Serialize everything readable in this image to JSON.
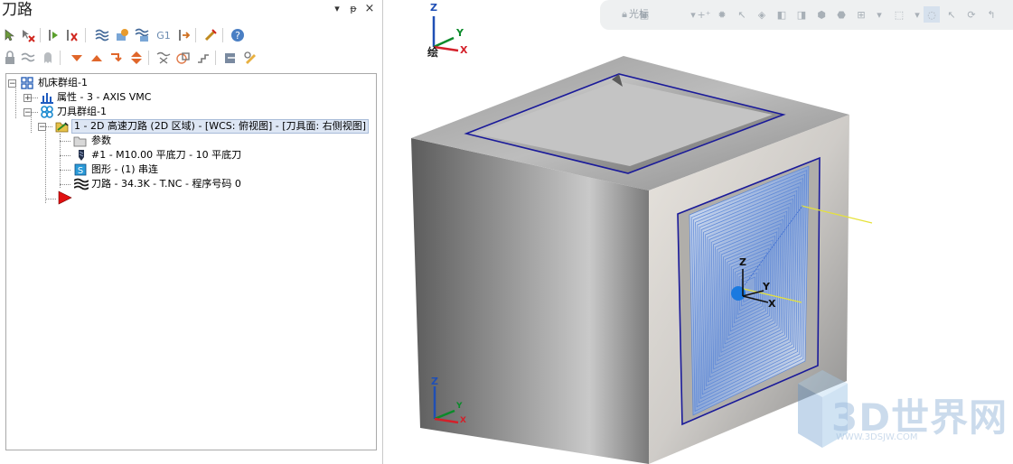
{
  "panel": {
    "title": "刀路",
    "controls": [
      "▾",
      "ᵽ",
      "×"
    ]
  },
  "toolbar1": {
    "g1_label": "G1"
  },
  "tree": {
    "machine_group": "机床群组-1",
    "properties": "属性 - 3 - AXIS VMC",
    "toolpath_group": "刀具群组-1",
    "operation": "1 - 2D 高速刀路 (2D 区域) - [WCS: 俯视图] - [刀具面: 右侧视图]",
    "params": "参数",
    "tool": "#1 - M10.00 平底刀 - 10 平底刀",
    "geometry": "图形 - (1) 串连",
    "toolpath": "刀路 - 34.3K - T.NC - 程序号码 0"
  },
  "viewport": {
    "cursor_label": "光标",
    "view_label": "绘",
    "axes": {
      "z": "Z",
      "y": "Y",
      "x": "X"
    },
    "colors": {
      "z_axis": "#1f4fb5",
      "y_axis": "#0b8a2a",
      "x_axis": "#d4202a",
      "chain": "#1a1aa8",
      "toolpath": "#4a7fd8"
    }
  },
  "watermark": {
    "text": "3D世界网",
    "sub": "WWW.3DSJW.COM"
  }
}
